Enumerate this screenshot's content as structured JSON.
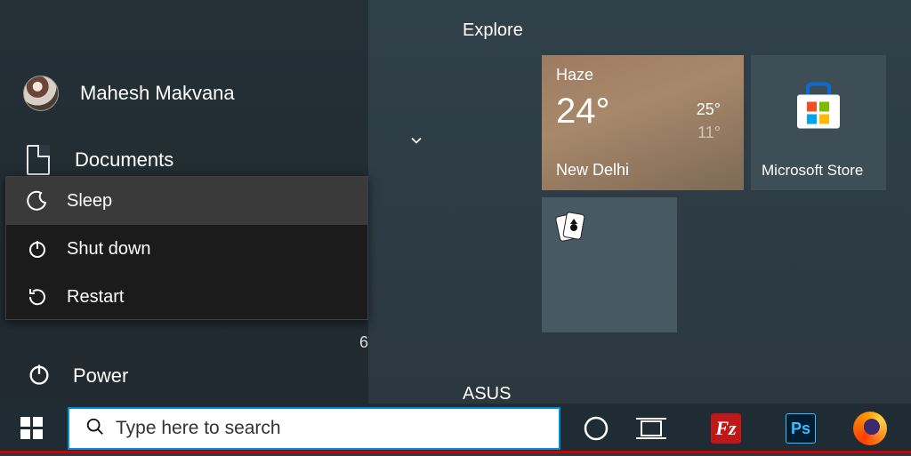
{
  "user": {
    "name": "Mahesh Makvana"
  },
  "sidebar": {
    "documents_label": "Documents",
    "power_label": "Power",
    "stray_digit": "6"
  },
  "power_menu": {
    "items": [
      {
        "label": "Sleep",
        "icon": "moon-icon"
      },
      {
        "label": "Shut down",
        "icon": "power-icon"
      },
      {
        "label": "Restart",
        "icon": "restart-icon"
      }
    ]
  },
  "groups": {
    "explore": "Explore",
    "asus": "ASUS"
  },
  "tiles": {
    "weather": {
      "condition": "Haze",
      "temp": "24°",
      "high": "25°",
      "low": "11°",
      "city": "New Delhi"
    },
    "store": {
      "label": "Microsoft Store"
    }
  },
  "taskbar": {
    "search_placeholder": "Type here to search"
  }
}
